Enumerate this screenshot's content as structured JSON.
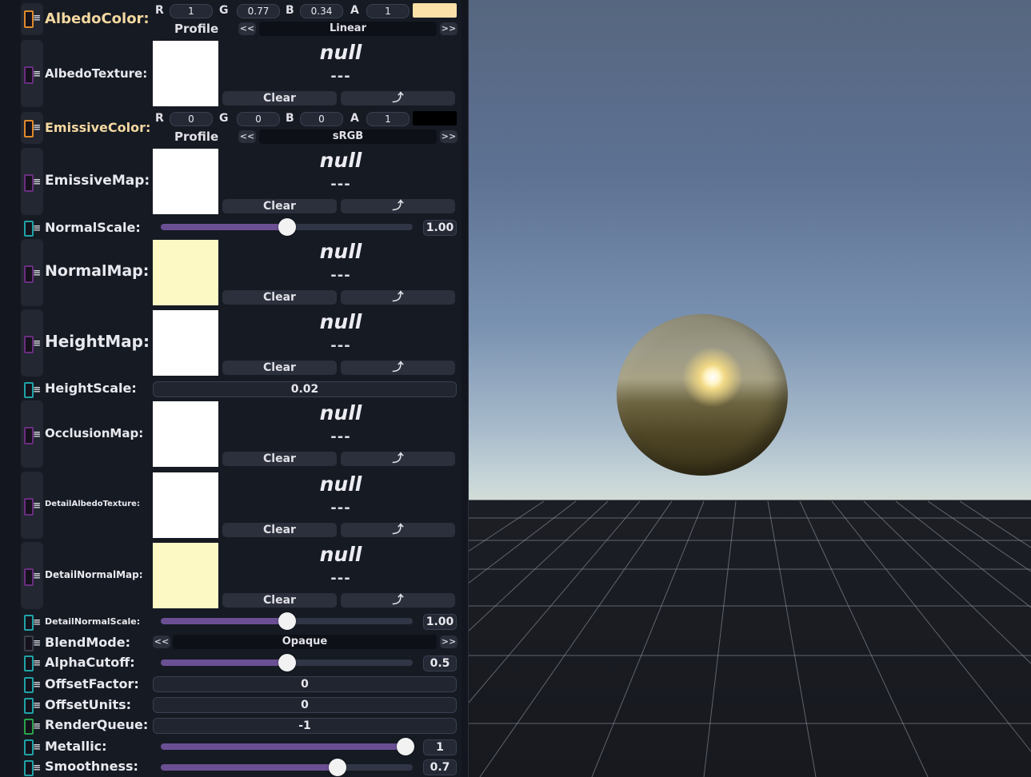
{
  "colors": {
    "accent_slider": "#6b4f93",
    "albedo_swatch": "#fbe0a8",
    "emissive_swatch": "#000000",
    "normal_thumb": "#fdf9c4",
    "height_thumb": "#ffffff"
  },
  "albedo_color": {
    "label": "AlbedoColor:",
    "r_letter": "R",
    "r": "1",
    "g_letter": "G",
    "g": "0.77",
    "b_letter": "B",
    "b": "0.34",
    "a_letter": "A",
    "a": "1",
    "profile_label": "Profile",
    "profile_prev": "<<",
    "profile_value": "Linear",
    "profile_next": ">>"
  },
  "albedo_texture": {
    "label": "AlbedoTexture:",
    "value": "null",
    "dashes": "---",
    "clear": "Clear",
    "jump": "⤴"
  },
  "emissive_color": {
    "label": "EmissiveColor:",
    "r_letter": "R",
    "r": "0",
    "g_letter": "G",
    "g": "0",
    "b_letter": "B",
    "b": "0",
    "a_letter": "A",
    "a": "1",
    "profile_label": "Profile",
    "profile_prev": "<<",
    "profile_value": "sRGB",
    "profile_next": ">>"
  },
  "emissive_map": {
    "label": "EmissiveMap:",
    "value": "null",
    "dashes": "---",
    "clear": "Clear",
    "jump": "⤴"
  },
  "normal_scale": {
    "label": "NormalScale:",
    "value": "1.00",
    "fraction": 0.5
  },
  "normal_map": {
    "label": "NormalMap:",
    "value": "null",
    "dashes": "---",
    "clear": "Clear",
    "jump": "⤴"
  },
  "height_map": {
    "label": "HeightMap:",
    "value": "null",
    "dashes": "---",
    "clear": "Clear",
    "jump": "⤴"
  },
  "height_scale": {
    "label": "HeightScale:",
    "value": "0.02"
  },
  "occlusion_map": {
    "label": "OcclusionMap:",
    "value": "null",
    "dashes": "---",
    "clear": "Clear",
    "jump": "⤴"
  },
  "detail_albedo_texture": {
    "label": "DetailAlbedoTexture:",
    "value": "null",
    "dashes": "---",
    "clear": "Clear",
    "jump": "⤴"
  },
  "detail_normal_map": {
    "label": "DetailNormalMap:",
    "value": "null",
    "dashes": "---",
    "clear": "Clear",
    "jump": "⤴"
  },
  "detail_normal_scale": {
    "label": "DetailNormalScale:",
    "value": "1.00",
    "fraction": 0.5
  },
  "blend_mode": {
    "label": "BlendMode:",
    "prev": "<<",
    "value": "Opaque",
    "next": ">>"
  },
  "alpha_cutoff": {
    "label": "AlphaCutoff:",
    "value": "0.5",
    "fraction": 0.5
  },
  "offset_factor": {
    "label": "OffsetFactor:",
    "value": "0"
  },
  "offset_units": {
    "label": "OffsetUnits:",
    "value": "0"
  },
  "render_queue": {
    "label": "RenderQueue:",
    "value": "-1"
  },
  "metallic": {
    "label": "Metallic:",
    "value": "1",
    "fraction": 1.0
  },
  "smoothness": {
    "label": "Smoothness:",
    "value": "0.7",
    "fraction": 0.7
  }
}
